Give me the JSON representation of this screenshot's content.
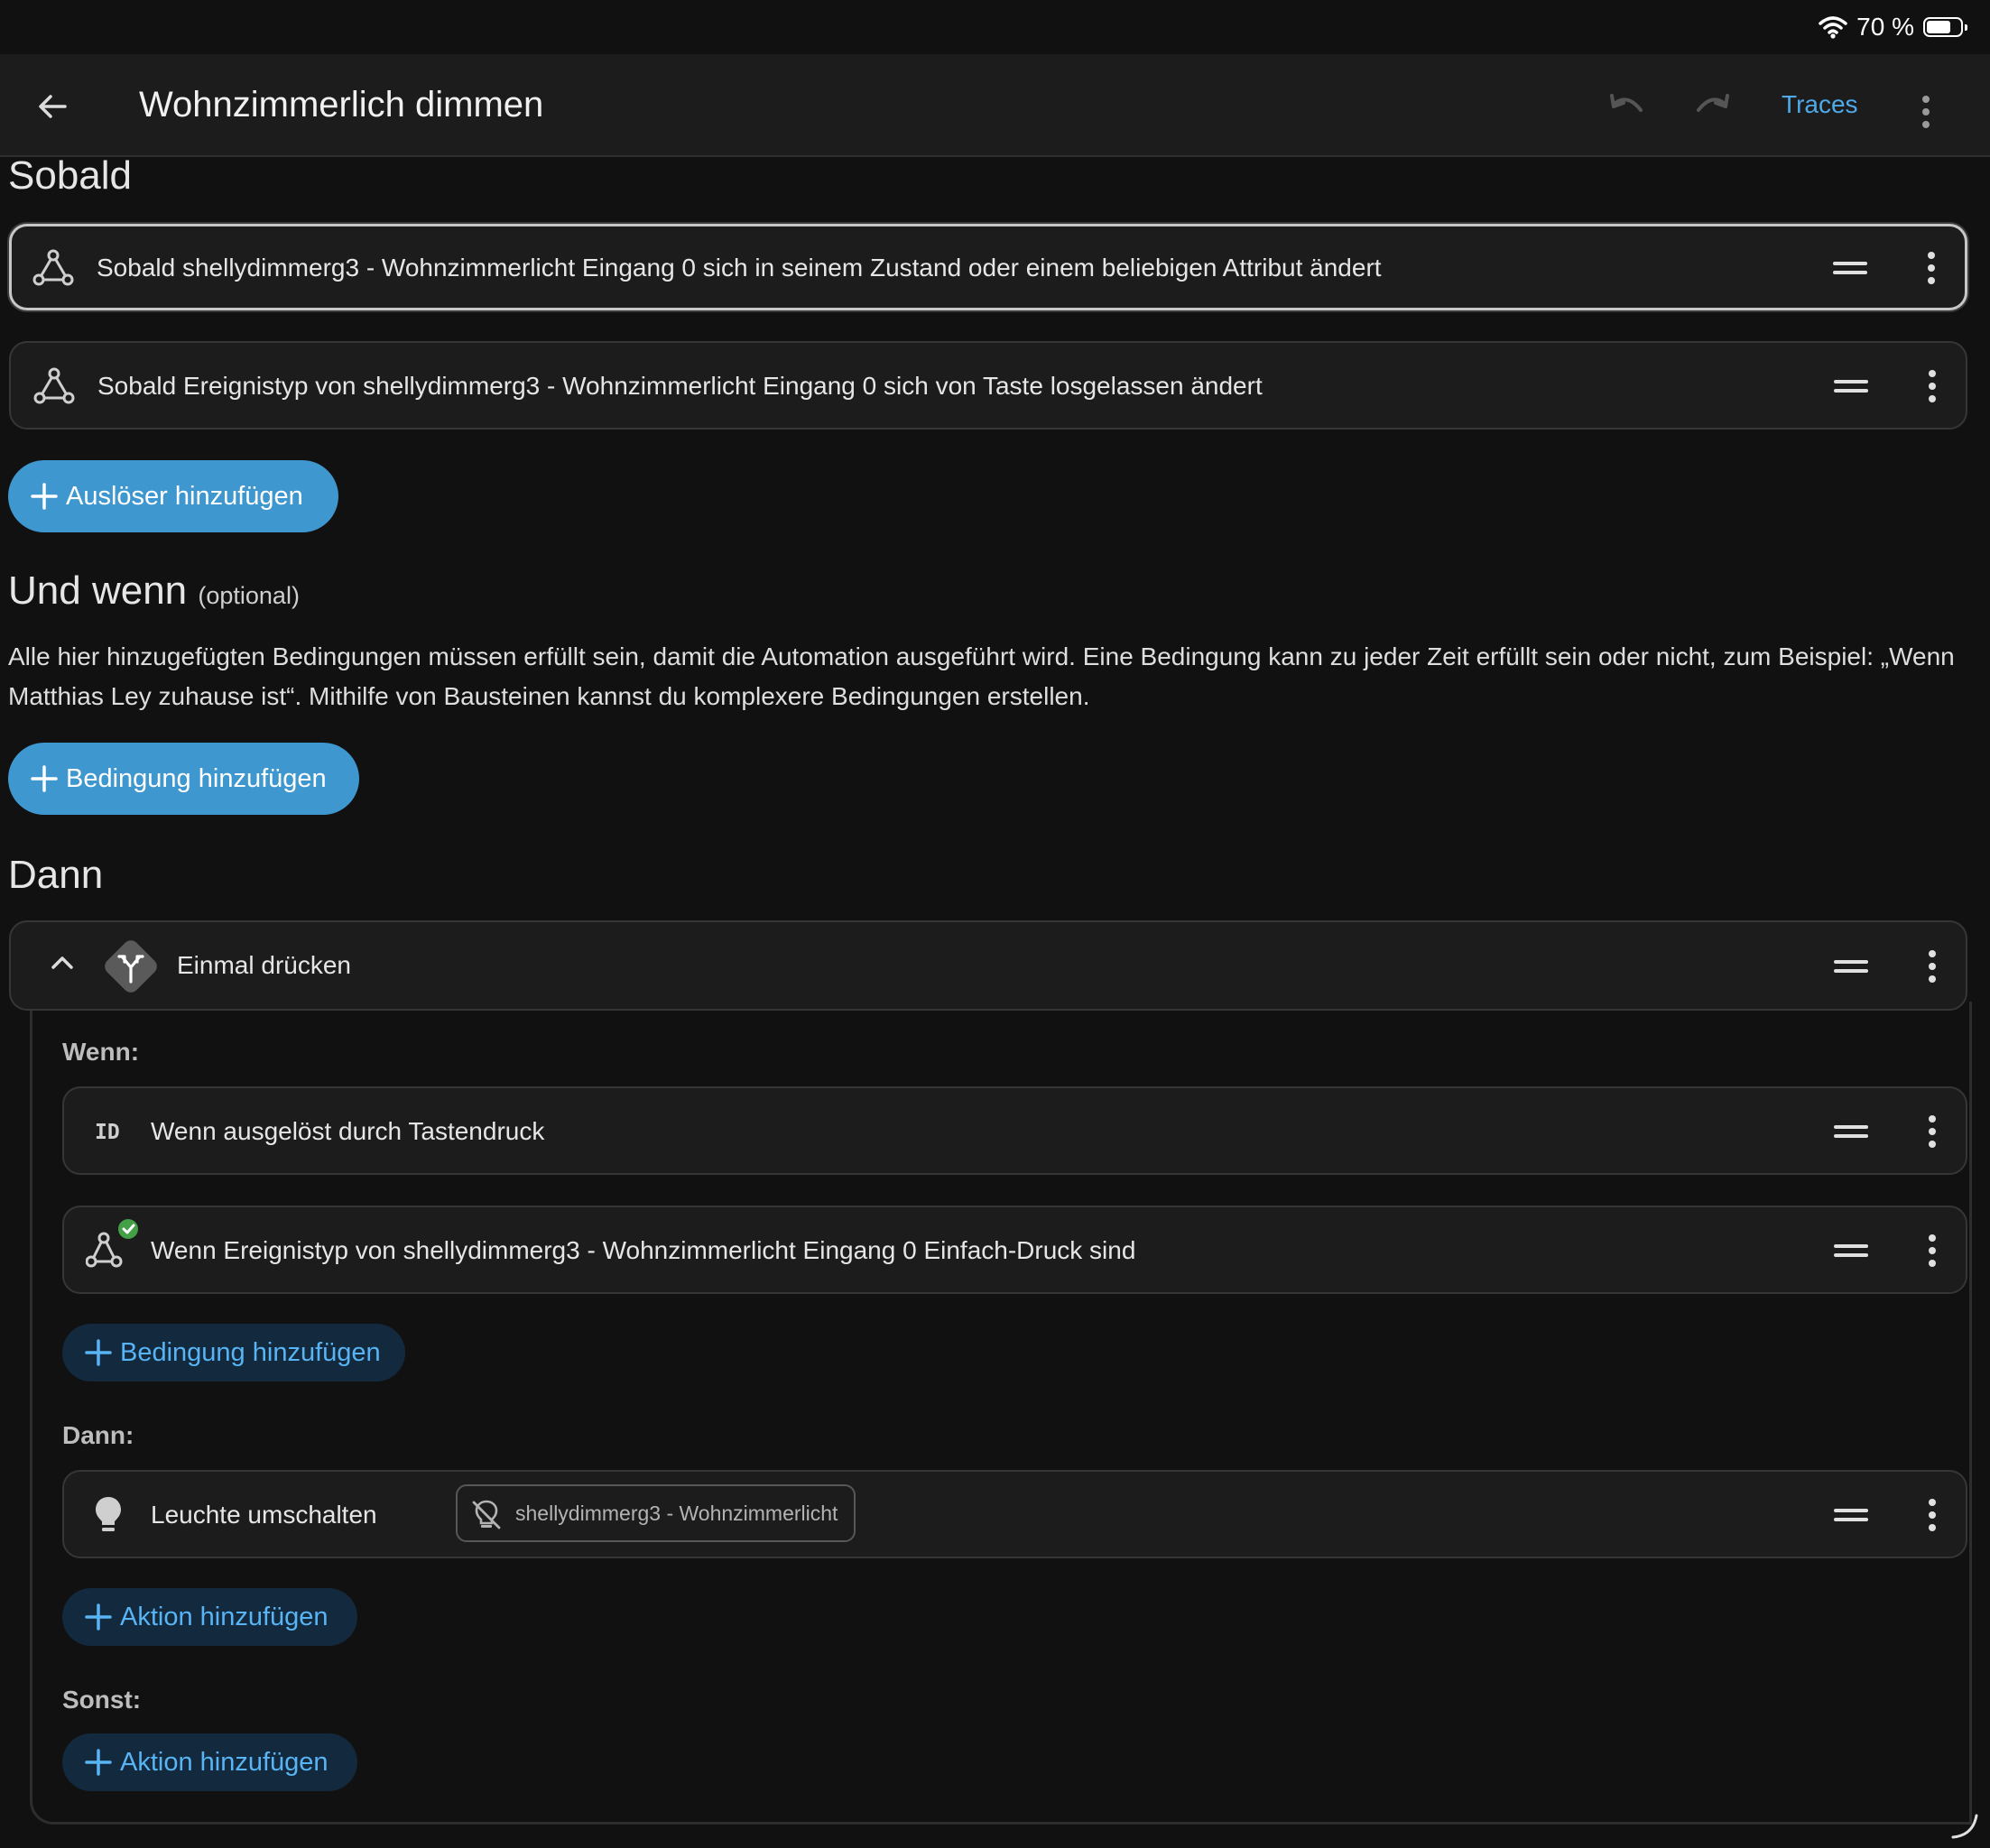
{
  "status": {
    "battery_text": "70 %",
    "battery_level": 0.7
  },
  "toolbar": {
    "title": "Wohnzimmerlich dimmen",
    "traces": "Traces"
  },
  "triggers": {
    "title": "Sobald",
    "items": [
      "Sobald shellydimmerg3 - Wohnzimmerlicht Eingang 0 sich in seinem Zustand oder einem beliebigen Attribut ändert",
      "Sobald Ereignistyp von shellydimmerg3 - Wohnzimmerlicht Eingang 0 sich von Taste losgelassen ändert"
    ],
    "add": "Auslöser hinzufügen"
  },
  "conditions": {
    "title": "Und wenn",
    "optional": "(optional)",
    "description": "Alle hier hinzugefügten Bedingungen müssen erfüllt sein, damit die Automation ausgeführt wird. Eine Bedingung kann zu jeder Zeit erfüllt sein oder nicht, zum Beispiel: „Wenn Matthias Ley zuhause ist“. Mithilfe von Bausteinen kannst du komplexere Bedingungen erstellen.",
    "add": "Bedingung hinzufügen"
  },
  "actions": {
    "title": "Dann",
    "choose": {
      "label": "Einmal drücken",
      "when_label": "Wenn:",
      "conditions": [
        "Wenn ausgelöst durch Tastendruck",
        "Wenn Ereignistyp von shellydimmerg3 - Wohnzimmerlicht Eingang 0 Einfach-Druck sind"
      ],
      "add_condition": "Bedingung hinzufügen",
      "then_label": "Dann:",
      "action_label": "Leuchte umschalten",
      "action_entity": "shellydimmerg3 - Wohnzimmerlicht",
      "add_action": "Aktion hinzufügen",
      "else_label": "Sonst:",
      "add_else_action": "Aktion hinzufügen"
    }
  }
}
